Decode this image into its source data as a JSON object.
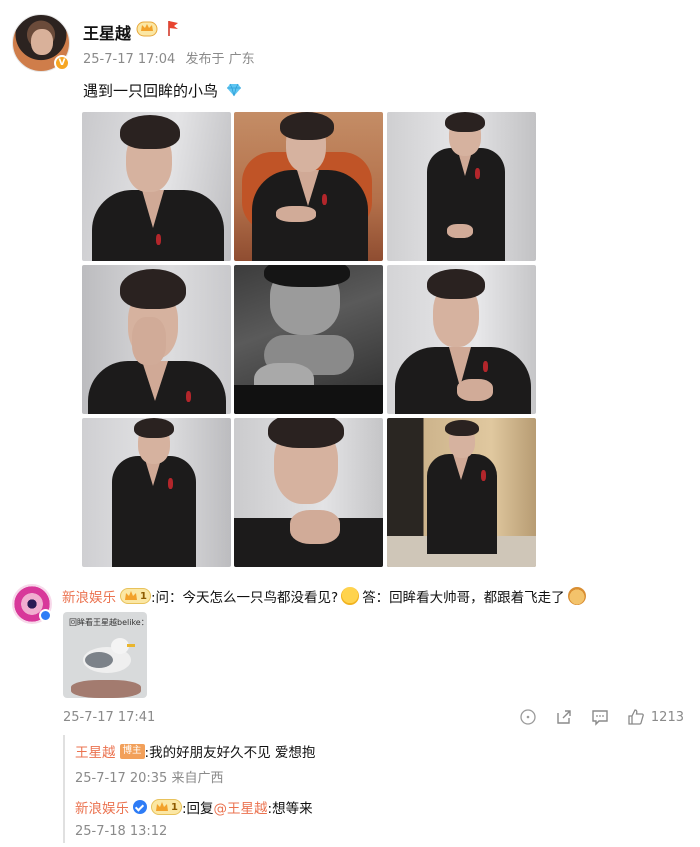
{
  "post": {
    "author": "王星越",
    "time": "25-7-17 17:04",
    "location": "发布于 广东",
    "text": "遇到一只回眸的小鸟",
    "photo_count": 9
  },
  "comment": {
    "author": "新浪娱乐",
    "vip_level": "1",
    "text_question": ":问：今天怎么一只鸟都没看见?",
    "text_answer": "答：回眸看大帅哥，都跟着飞走了",
    "image_caption": "回眸看王星越belike：",
    "time": "25-7-17 17:41",
    "like_count": "1213"
  },
  "replies": [
    {
      "author": "王星越",
      "badge": "博主",
      "text": ":我的好朋友好久不见 爱想抱",
      "time": "25-7-17 20:35 来自广西"
    },
    {
      "author": "新浪娱乐",
      "vip_level": "1",
      "prefix": ":回复",
      "mention": "@王星越",
      "text": ":想等来",
      "time": "25-7-18 13:12"
    }
  ],
  "colors": {
    "accent_name": "#eb7350",
    "meta_text": "#8a8a8a",
    "verified_blue": "#2e7cf6",
    "vip_gold": "#fbe7a4"
  },
  "icons": [
    "crown-icon",
    "flag-icon",
    "diamond-icon",
    "verified-icon",
    "share-icon",
    "comment-icon",
    "like-icon",
    "more-icon"
  ]
}
